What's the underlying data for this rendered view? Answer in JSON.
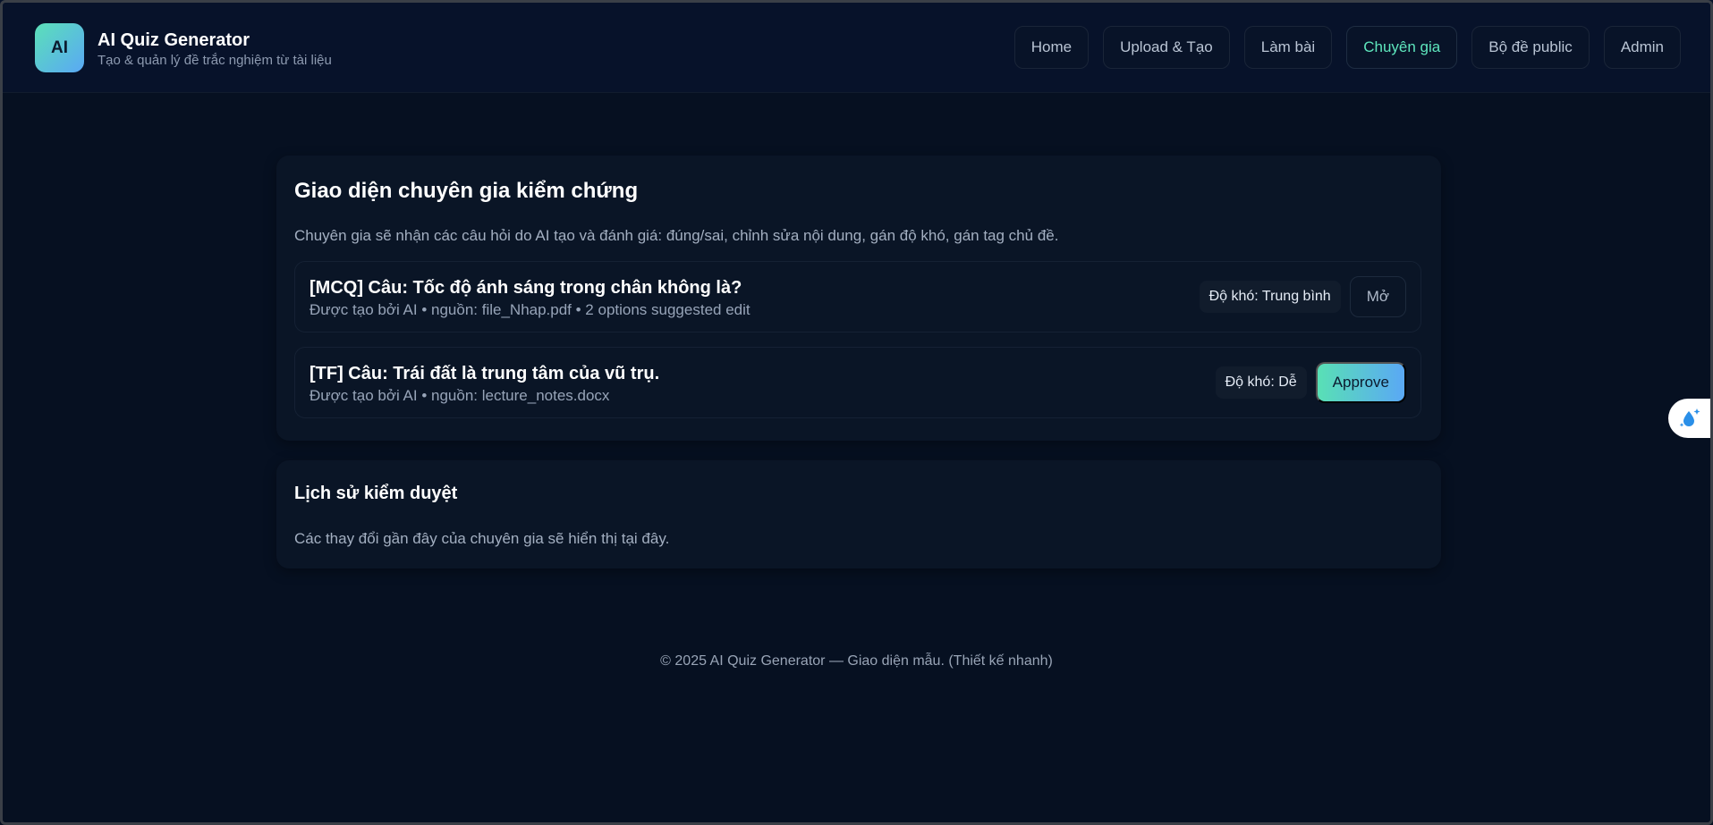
{
  "brand": {
    "logo_text": "AI",
    "title": "AI Quiz Generator",
    "subtitle": "Tạo & quản lý đề trắc nghiệm từ tài liệu"
  },
  "nav": [
    {
      "label": "Home"
    },
    {
      "label": "Upload & Tạo"
    },
    {
      "label": "Làm bài"
    },
    {
      "label": "Chuyên gia",
      "active": true
    },
    {
      "label": "Bộ đề public"
    },
    {
      "label": "Admin"
    }
  ],
  "review": {
    "title": "Giao diện chuyên gia kiểm chứng",
    "description": "Chuyên gia sẽ nhận các câu hỏi do AI tạo và đánh giá: đúng/sai, chỉnh sửa nội dung, gán độ khó, gán tag chủ đề.",
    "questions": [
      {
        "title": "[MCQ] Câu: Tốc độ ánh sáng trong chân không là?",
        "meta": "Được tạo bởi AI • nguồn: file_Nhap.pdf • 2 options suggested edit",
        "difficulty": "Độ khó: Trung bình",
        "action": "Mở"
      },
      {
        "title": "[TF] Câu: Trái đất là trung tâm của vũ trụ.",
        "meta": "Được tạo bởi AI • nguồn: lecture_notes.docx",
        "difficulty": "Độ khó: Dễ",
        "action": "Approve"
      }
    ]
  },
  "history": {
    "title": "Lịch sử kiểm duyệt",
    "description": "Các thay đổi gần đây của chuyên gia sẽ hiển thị tại đây."
  },
  "footer": {
    "text": "© 2025 AI Quiz Generator — Giao diện mẫu. (Thiết kế nhanh)"
  },
  "colors": {
    "background": "#061021",
    "card": "#0a1526",
    "accent": "#5ee6bd",
    "gradient_start": "#59e0b5",
    "gradient_end": "#5aa8f5"
  },
  "icons": {
    "float_widget": "sparkle-drop-icon"
  }
}
